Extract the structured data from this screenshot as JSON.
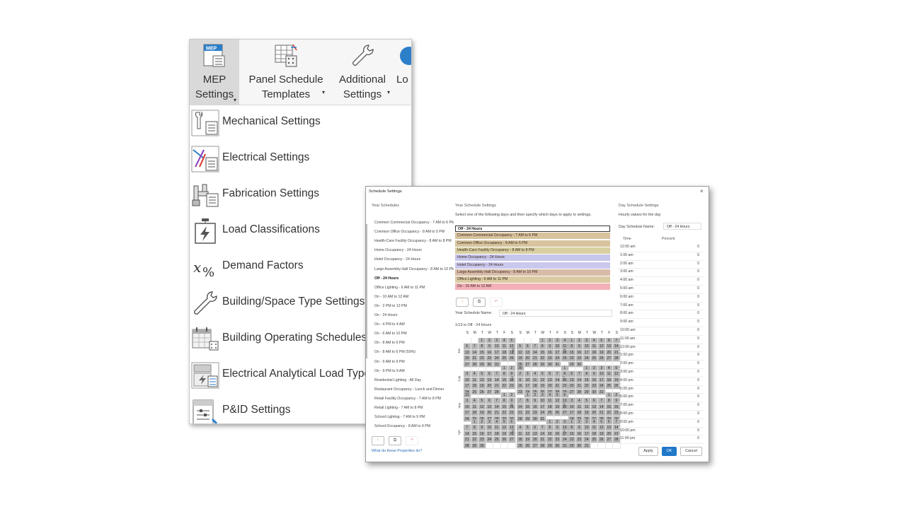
{
  "ribbon": {
    "buttons": [
      {
        "line1": "MEP",
        "line2": "Settings"
      },
      {
        "line1": "Panel Schedule",
        "line2": "Templates"
      },
      {
        "line1": "Additional",
        "line2": "Settings"
      },
      {
        "line1": "Lo",
        "line2": ""
      }
    ],
    "mep_badge": "MEP",
    "menu": [
      {
        "label": "Mechanical Settings",
        "icon": "mechanical-settings-icon"
      },
      {
        "label": "Electrical Settings",
        "icon": "electrical-settings-icon"
      },
      {
        "label": "Fabrication Settings",
        "icon": "fabrication-settings-icon"
      },
      {
        "label": "Load Classifications",
        "icon": "load-classifications-icon"
      },
      {
        "label": "Demand Factors",
        "icon": "demand-factors-icon"
      },
      {
        "label": "Building/Space Type Settings",
        "icon": "wrench-icon"
      },
      {
        "label": "Building Operating Schedules",
        "icon": "calendar-icon"
      },
      {
        "label": "Electrical Analytical Load Type",
        "icon": "electrical-load-type-icon"
      },
      {
        "label": "P&ID Settings",
        "icon": "pid-settings-icon"
      }
    ]
  },
  "dialog": {
    "title": "Schedule Settings",
    "close": "×",
    "year_schedules": {
      "heading": "Year Schedules",
      "items": [
        "Common Commercial Occupancy - 7 AM to 6 PM",
        "Common Office Occupancy - 8 AM to 5 PM",
        "Health-Care Facility Occupancy - 8 AM to 8 PM",
        "Home Occupancy - 24 Hours",
        "Hotel Occupancy - 24 Hours",
        "Large Assembly Hall Occupancy - 8 AM to 10 PM",
        "Off - 24 Hours",
        "Office Lighting - 6 AM to 11 PM",
        "On - 10 AM to 12 AM",
        "On - 2 PM to 12 PM",
        "On - 24 Hours",
        "On - 4 PM to 4 AM",
        "On - 6 AM to 10 PM",
        "On - 8 AM to 6 PM",
        "On - 8 AM to 6 PM (50%)",
        "On - 9 AM to 9 PM",
        "On - 9 PM to 9 AM",
        "Residential Lighting - All Day",
        "Restaurant Occupancy - Lunch and Dinner",
        "Retail Facility Occupancy - 7 AM to 8 PM",
        "Retail Lighting - 7 AM to 8 PM",
        "School Lighting - 7 AM to 9 PM",
        "School Occupancy - 8 AM to 9 PM"
      ],
      "selected_index": 6
    },
    "year_settings": {
      "heading": "Year Schedule Settings",
      "instruction": "Select one of the following days and then specify which days to apply to settings.",
      "day_schedules": [
        {
          "label": "Off - 24 Hours",
          "color": "#ffffff"
        },
        {
          "label": "Common Commercial Occupancy - 7 AM to 6 PM",
          "color": "#d8c29c"
        },
        {
          "label": "Common Office Occupancy - 8 AM to 5 PM",
          "color": "#d7c49e"
        },
        {
          "label": "Health-Care Facility Occupancy - 8 AM to 8 PM",
          "color": "#d8cfa2"
        },
        {
          "label": "Home Occupancy - 24 Hours",
          "color": "#c7c6ec"
        },
        {
          "label": "Hotel Occupancy - 24 Hours",
          "color": "#cbc8ee"
        },
        {
          "label": "Large Assembly Hall Occupancy - 8 AM to 10 PM",
          "color": "#d8bca9"
        },
        {
          "label": "Office Lighting - 6 AM to 11 PM",
          "color": "#dbcba3"
        },
        {
          "label": "On - 10 AM to 12 AM",
          "color": "#f3b1b7"
        }
      ],
      "schedule_name_label": "Year Schedule Name:",
      "schedule_name_value": "Off - 24 Hours",
      "summary": "1/13 is Off - 24 Hours",
      "weekdays": [
        "S",
        "M",
        "T",
        "W",
        "T",
        "F",
        "S"
      ],
      "months": [
        "Jan",
        "Feb",
        "Mar",
        "Apr",
        "May",
        "Jun",
        "Jul",
        "Aug",
        "Sep",
        "Oct",
        "Nov",
        "Dec"
      ]
    },
    "day_settings": {
      "heading": "Day Schedule Settings",
      "subheading": "Hourly values for the day",
      "name_label": "Day Schedule Name:",
      "name_value": "Off - 24 Hours",
      "col_time": "Time",
      "col_percent": "Percent",
      "hours": [
        {
          "time": "12:00 am",
          "value": "0"
        },
        {
          "time": "1:00 am",
          "value": "0"
        },
        {
          "time": "2:00 am",
          "value": "0"
        },
        {
          "time": "3:00 am",
          "value": "0"
        },
        {
          "time": "4:00 am",
          "value": "0"
        },
        {
          "time": "5:00 am",
          "value": "0"
        },
        {
          "time": "6:00 am",
          "value": "0"
        },
        {
          "time": "7:00 am",
          "value": "0"
        },
        {
          "time": "8:00 am",
          "value": "0"
        },
        {
          "time": "9:00 am",
          "value": "0"
        },
        {
          "time": "10:00 am",
          "value": "0"
        },
        {
          "time": "11:00 am",
          "value": "0"
        },
        {
          "time": "12:00 pm",
          "value": "0"
        },
        {
          "time": "1:00 pm",
          "value": "0"
        },
        {
          "time": "2:00 pm",
          "value": "0"
        },
        {
          "time": "3:00 pm",
          "value": "0"
        },
        {
          "time": "4:00 pm",
          "value": "0"
        },
        {
          "time": "5:00 pm",
          "value": "0"
        },
        {
          "time": "6:00 pm",
          "value": "0"
        },
        {
          "time": "7:00 pm",
          "value": "0"
        },
        {
          "time": "8:00 pm",
          "value": "0"
        },
        {
          "time": "9:00 pm",
          "value": "0"
        },
        {
          "time": "10:00 pm",
          "value": "0"
        },
        {
          "time": "11:00 pm",
          "value": "0"
        }
      ]
    },
    "help_link": "What do these Properties do?",
    "buttons": {
      "apply": "Apply",
      "ok": "OK",
      "cancel": "Cancel"
    }
  }
}
